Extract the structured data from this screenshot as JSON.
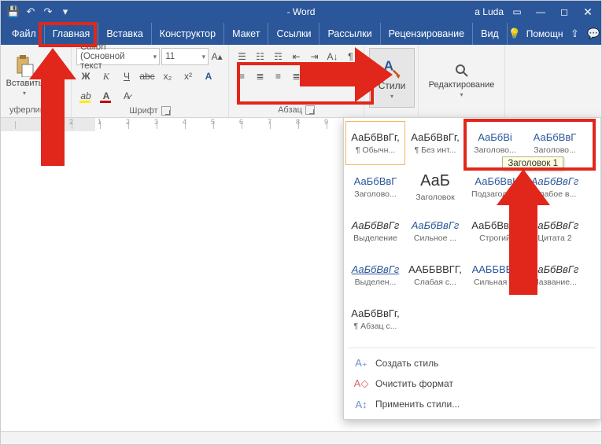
{
  "title": "- Word",
  "user": "a Luda",
  "qat": {
    "save": "💾",
    "undo": "↶",
    "redo": "↷",
    "custom": "▾"
  },
  "tabs": {
    "file": "Файл",
    "home": "Главная",
    "insert": "Вставка",
    "design": "Конструктор",
    "layout": "Макет",
    "refs": "Ссылки",
    "mail": "Рассылки",
    "review": "Рецензирование",
    "view": "Вид",
    "help": "Помощн"
  },
  "ribbon": {
    "clipboard": {
      "paste": "Вставить",
      "caption": "уферлина"
    },
    "font": {
      "name": "Calibri (Основной текст",
      "size": "11",
      "caption": "Шрифт"
    },
    "para": {
      "caption": "Абзац"
    },
    "styles": {
      "label": "Стили"
    },
    "editing": {
      "label": "Редактирование"
    }
  },
  "gallery": [
    {
      "prev": "АаБбВвГг,",
      "lab": "¶ Обычн...",
      "cls": "sel"
    },
    {
      "prev": "АаБбВвГг,",
      "lab": "¶ Без инт..."
    },
    {
      "prev": "АаБбВі",
      "lab": "Заголово...",
      "cls": "blue"
    },
    {
      "prev": "АаБбВвГ",
      "lab": "Заголово...",
      "cls": "blue"
    },
    {
      "prev": "АаБбВвГ",
      "lab": "Заголово...",
      "cls": "blue"
    },
    {
      "prev": "АаБ",
      "lab": "Заголовок",
      "cls": "big"
    },
    {
      "prev": "АаБбВвІ",
      "lab": "Подзаголо...",
      "cls": "blue"
    },
    {
      "prev": "АаБбВвГг",
      "lab": "Слабое в...",
      "cls": "blue it"
    },
    {
      "prev": "АаБбВвГг",
      "lab": "Выделение",
      "cls": "it"
    },
    {
      "prev": "АаБбВвГг",
      "lab": "Сильное ...",
      "cls": "blue it"
    },
    {
      "prev": "АаБбВвГг",
      "lab": "Строгий"
    },
    {
      "prev": "АаБбВвГг",
      "lab": "Цитата 2",
      "cls": "it"
    },
    {
      "prev": "АаБбВвГг",
      "lab": "Выделен...",
      "cls": "blue it ul"
    },
    {
      "prev": "ААББВВГГ,",
      "lab": "Слабая с...",
      "cls": "caps"
    },
    {
      "prev": "ААББВВГ",
      "lab": "Сильная ...",
      "cls": "caps blue"
    },
    {
      "prev": "АаБбВвГг",
      "lab": "Название...",
      "cls": "it"
    },
    {
      "prev": "АаБбВвГг,",
      "lab": "¶ Абзац с..."
    }
  ],
  "tooltip": "Заголовок 1",
  "menu": {
    "create": "Создать стиль",
    "clear": "Очистить формат",
    "apply": "Применить стили..."
  }
}
